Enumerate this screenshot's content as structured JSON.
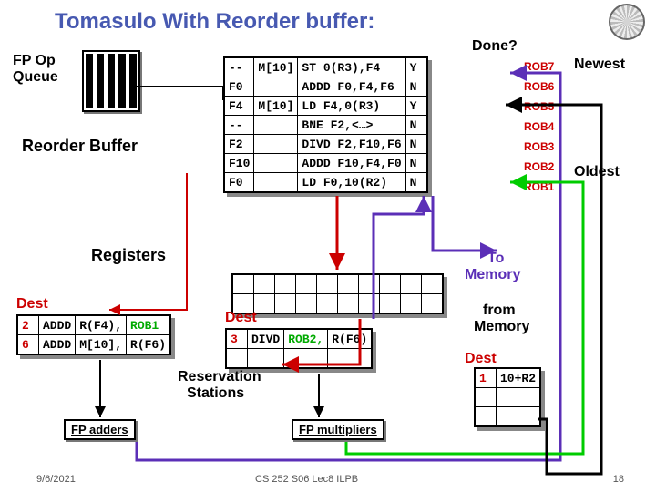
{
  "title": "Tomasulo With Reorder buffer:",
  "labels": {
    "fp_queue1": "FP Op",
    "fp_queue2": "Queue",
    "reorder_buffer": "Reorder Buffer",
    "done": "Done?",
    "newest": "Newest",
    "oldest": "Oldest",
    "registers": "Registers",
    "dest_adders": "Dest",
    "dest_mults": "Dest",
    "dest_mem": "Dest",
    "reservation": "Reservation",
    "stations": "Stations",
    "to_memory1": "To",
    "to_memory2": "Memory",
    "from_memory1": "from",
    "from_memory2": "Memory",
    "fp_adders": "FP adders",
    "fp_multipliers": "FP multipliers"
  },
  "reorder_buffer": {
    "rows": [
      {
        "dest": "--",
        "src": "M[10]",
        "instr": "ST 0(R3),F4",
        "done": "Y",
        "rob": "ROB7"
      },
      {
        "dest": "F0",
        "src": "",
        "instr": "ADDD F0,F4,F6",
        "done": "N",
        "rob": "ROB6"
      },
      {
        "dest": "F4",
        "src": "M[10]",
        "instr": "LD F4,0(R3)",
        "done": "Y",
        "rob": "ROB5"
      },
      {
        "dest": "--",
        "src": "",
        "instr": "BNE F2,<…>",
        "done": "N",
        "rob": "ROB4"
      },
      {
        "dest": "F2",
        "src": "",
        "instr": "DIVD F2,F10,F6",
        "done": "N",
        "rob": "ROB3"
      },
      {
        "dest": "F10",
        "src": "",
        "instr": "ADDD F10,F4,F0",
        "done": "N",
        "rob": "ROB2"
      },
      {
        "dest": "F0",
        "src": "",
        "instr": "LD F0,10(R2)",
        "done": "N",
        "rob": "ROB1"
      }
    ]
  },
  "adders_rs": [
    {
      "tag": "2",
      "op": "ADDD",
      "s1": "R(F4),",
      "s2": "ROB1"
    },
    {
      "tag": "6",
      "op": "ADDD",
      "s1": "M[10],",
      "s2": "R(F6)"
    }
  ],
  "mult_rs": [
    {
      "tag": "3",
      "op": "DIVD",
      "s1": "ROB2,",
      "s2": "R(F6)"
    }
  ],
  "mem_rs": {
    "tag": "1",
    "addr": "10+R2"
  },
  "footer": {
    "left": "9/6/2021",
    "mid": "CS 252 S06 Lec8 ILPB",
    "right": "18"
  }
}
